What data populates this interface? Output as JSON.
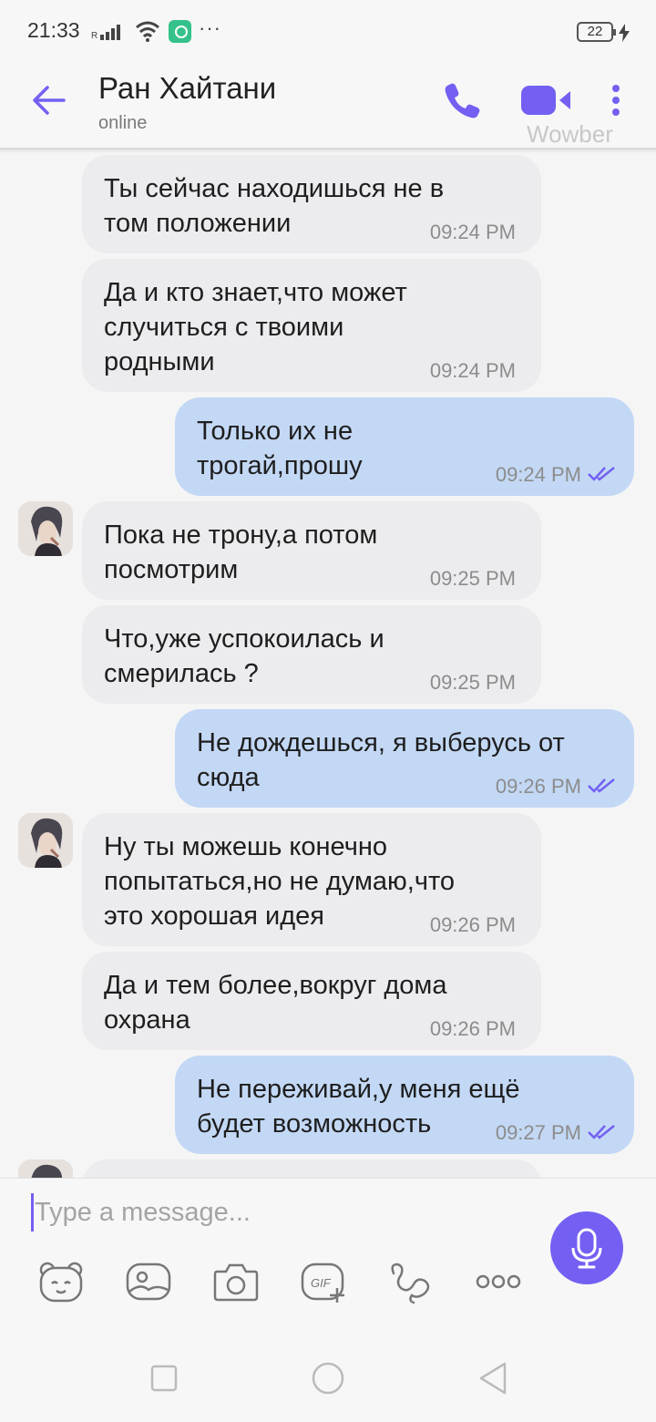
{
  "status_bar": {
    "time": "21:33",
    "more": "···",
    "battery": "22"
  },
  "header": {
    "contact_name": "Ран Хайтани",
    "contact_status": "online",
    "watermark": "Wowber"
  },
  "messages": [
    {
      "dir": "in",
      "text": "Ты сейчас находишься не в\nтом положении",
      "time": "09:24 PM"
    },
    {
      "dir": "in",
      "text": "Да и кто знает,что может\nслучиться с твоими\nродными",
      "time": "09:24 PM"
    },
    {
      "dir": "out",
      "text": "Только их не\nтрогай,прошу",
      "time": "09:24 PM",
      "read": true
    },
    {
      "dir": "in",
      "text": "Пока не трону,а потом\nпосмотрим",
      "time": "09:25 PM"
    },
    {
      "dir": "in",
      "text": "Что,уже успокоилась и\nсмерилась ?",
      "time": "09:25 PM"
    },
    {
      "dir": "out",
      "text": "Не дождешься, я выберусь от\nсюда",
      "time": "09:26 PM",
      "read": true
    },
    {
      "dir": "in",
      "text": "Ну ты можешь конечно\nпопытаться,но не думаю,что\nэто хорошая идея",
      "time": "09:26 PM"
    },
    {
      "dir": "in",
      "text": "Да и тем более,вокруг дома\nохрана",
      "time": "09:26 PM"
    },
    {
      "dir": "out",
      "text": "Не переживай,у меня ещё\nбудет возможность",
      "time": "09:27 PM",
      "read": true
    }
  ],
  "composer": {
    "placeholder": "Type a message..."
  },
  "colors": {
    "accent": "#7360f2",
    "incoming_bubble": "#ececef",
    "outgoing_bubble": "#c3d8f5"
  },
  "icons": {
    "back": "arrow-left-icon",
    "call": "phone-icon",
    "video": "video-camera-icon",
    "menu": "kebab-menu-icon",
    "mic": "microphone-icon",
    "tools": [
      "sticker-icon",
      "gallery-icon",
      "camera-icon",
      "gif-icon",
      "doodle-icon",
      "more-icon"
    ]
  }
}
